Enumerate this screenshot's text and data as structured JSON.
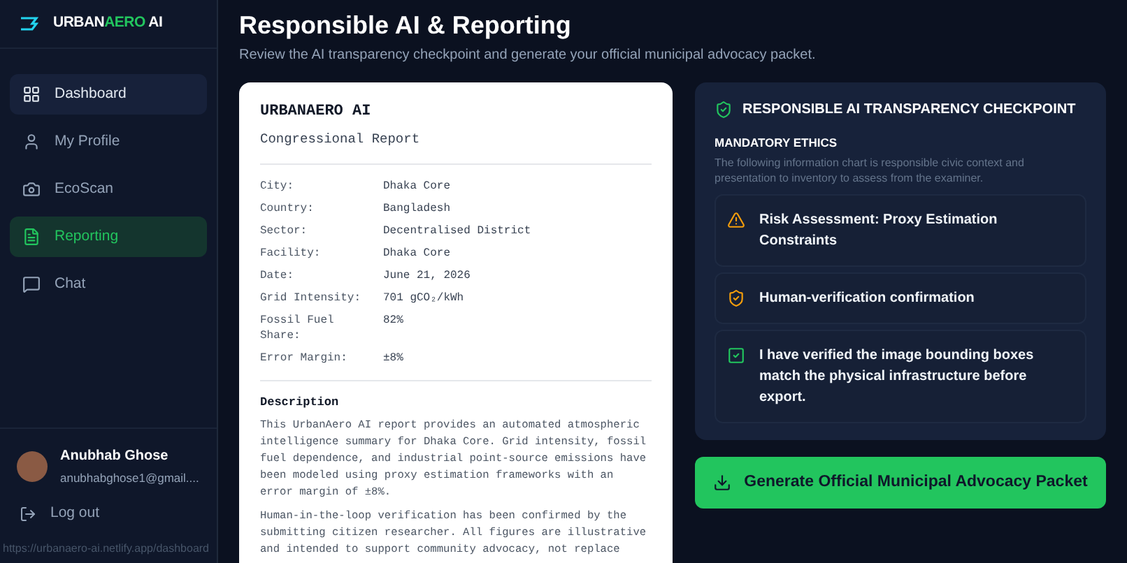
{
  "logo": [
    {
      "text": "URBAN",
      "accent": false
    },
    {
      "text": "AERO",
      "accent": true
    },
    {
      "text": " AI",
      "accent": false
    }
  ],
  "sidebar": {
    "items": [
      {
        "label": "Dashboard",
        "selected": false,
        "hovered": true
      },
      {
        "label": "My Profile",
        "selected": false,
        "hovered": false
      },
      {
        "label": "EcoScan",
        "selected": false,
        "hovered": false
      },
      {
        "label": "Reporting",
        "selected": true,
        "hovered": false
      },
      {
        "label": "Chat",
        "selected": false,
        "hovered": false
      }
    ],
    "user": {
      "name": "Anubhab Ghose",
      "email": "anubhabghose1@gmail...."
    },
    "logout": "Log out"
  },
  "status_url": "https://urbanaero-ai.netlify.app/dashboard",
  "page": {
    "title": "Responsible AI & Reporting",
    "subtitle": "Review the AI transparency checkpoint and generate your official municipal advocacy packet."
  },
  "report": {
    "brand": "URBANAERO AI",
    "subtitle": "Congressional Report",
    "fields": [
      {
        "label": "City:",
        "value": "Dhaka Core"
      },
      {
        "label": "Country:",
        "value": "Bangladesh"
      },
      {
        "label": "Sector:",
        "value": "Decentralised District"
      },
      {
        "label": "Facility:",
        "value": "Dhaka Core"
      },
      {
        "label": "Date:",
        "value": "June 21, 2026"
      },
      {
        "label": "Grid Intensity:",
        "value": "701 gCO₂/kWh"
      },
      {
        "label": "Fossil Fuel Share:",
        "value": "82%"
      },
      {
        "label": "Error Margin:",
        "value": "±8%"
      }
    ],
    "description_heading": "Description",
    "paragraphs": [
      "This UrbanAero AI report provides an automated atmospheric intelligence summary for Dhaka Core. Grid intensity, fossil fuel dependence, and industrial point-source emissions have been modeled using proxy estimation frameworks with an error margin of ±8%.",
      "Human-in-the-loop verification has been confirmed by the submitting citizen researcher. All figures are illustrative and intended to support community advocacy, not replace"
    ]
  },
  "checkpoint": {
    "title": "RESPONSIBLE AI TRANSPARENCY CHECKPOINT",
    "section": "MANDATORY ETHICS",
    "description": "The following information chart is responsible civic context and presentation to inventory to assess from the examiner.",
    "items": [
      {
        "kind": "warning",
        "text": "Risk Assessment: Proxy Estimation Constraints"
      },
      {
        "kind": "shield",
        "text": "Human-verification confirmation"
      },
      {
        "kind": "checkbox",
        "checked": true,
        "text": "I have verified the image bounding boxes match the physical infrastructure before export."
      }
    ]
  },
  "generate_button": "Generate Official Municipal Advocacy Packet"
}
